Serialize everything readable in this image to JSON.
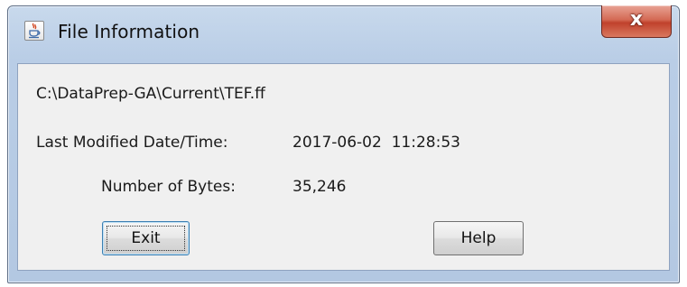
{
  "window": {
    "title": "File Information",
    "close_label": "x",
    "app_icon": "java-cup-icon"
  },
  "info": {
    "path": "C:\\DataPrep-GA\\Current\\TEF.ff",
    "modified_label": "Last Modified Date/Time:",
    "modified_value": "2017-06-02  11:28:53",
    "bytes_label": "Number of Bytes:",
    "bytes_value": "35,246"
  },
  "buttons": {
    "exit_label": "Exit",
    "help_label": "Help"
  }
}
